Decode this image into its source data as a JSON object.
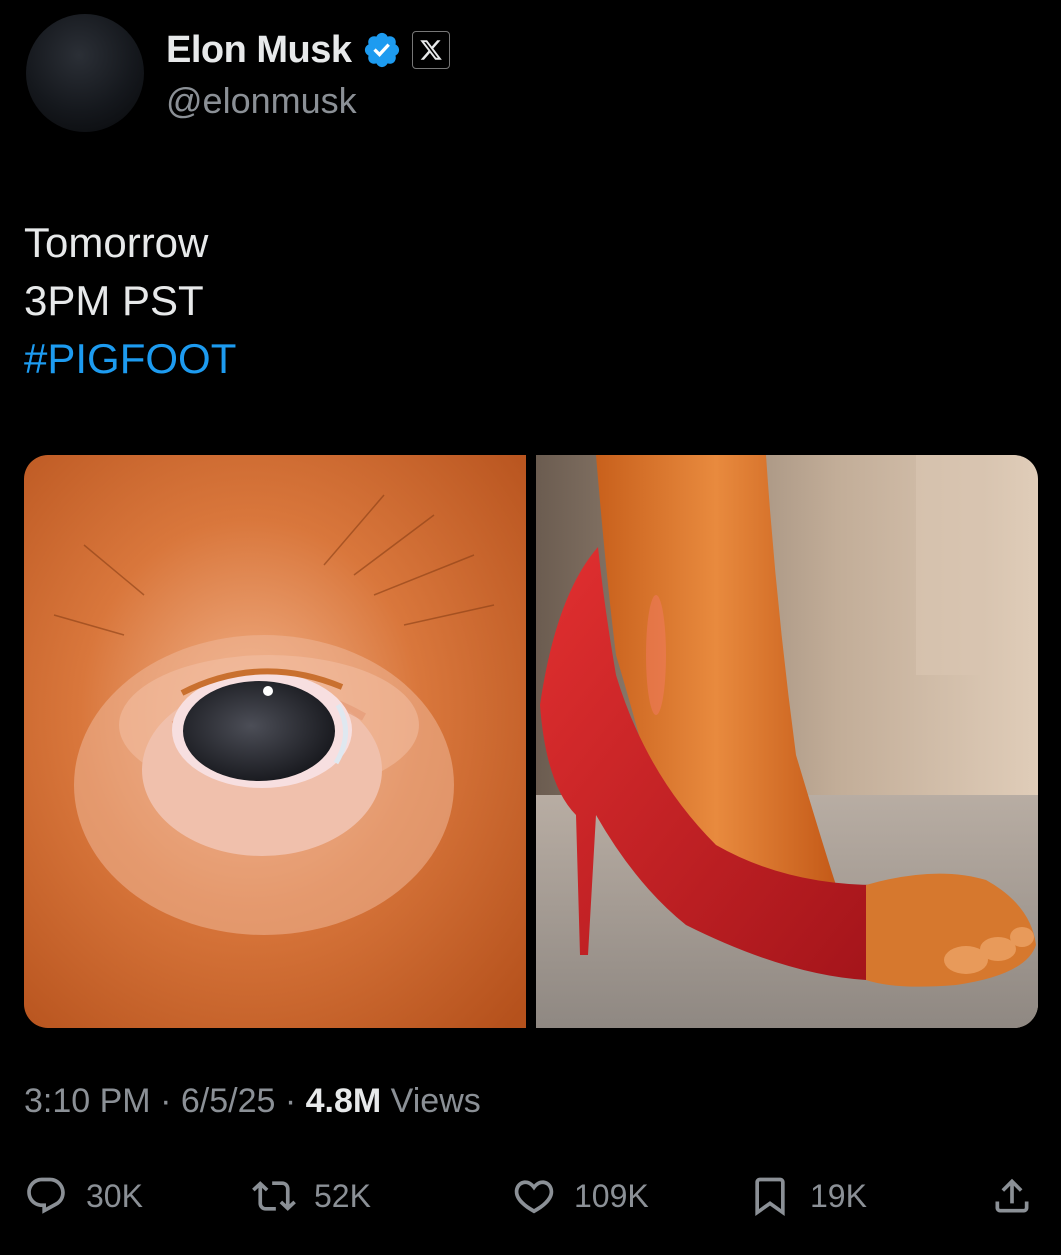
{
  "author": {
    "display_name": "Elon Musk",
    "handle": "@elonmusk",
    "verified_icon": "verified-badge-icon",
    "affiliation_icon": "x-logo-icon",
    "verified_color": "#1d9bf0"
  },
  "tweet": {
    "lines": [
      "Tomorrow",
      "3PM PST"
    ],
    "hashtag": "#PIGFOOT",
    "hashtag_color": "#1d9bf0"
  },
  "media": [
    {
      "name": "pig-eye-image"
    },
    {
      "name": "pig-foot-heel-image"
    }
  ],
  "meta": {
    "time": "3:10 PM",
    "separator": "·",
    "date": "6/5/25",
    "views_count": "4.8M",
    "views_label": "Views"
  },
  "actions": {
    "replies": {
      "count": "30K",
      "icon": "reply-icon"
    },
    "reposts": {
      "count": "52K",
      "icon": "repost-icon"
    },
    "likes": {
      "count": "109K",
      "icon": "heart-icon"
    },
    "bookmarks": {
      "count": "19K",
      "icon": "bookmark-icon"
    },
    "share": {
      "icon": "share-icon"
    }
  },
  "colors": {
    "background": "#000000",
    "text_primary": "#e7e9ea",
    "text_secondary": "#8b9096",
    "accent": "#1d9bf0"
  }
}
